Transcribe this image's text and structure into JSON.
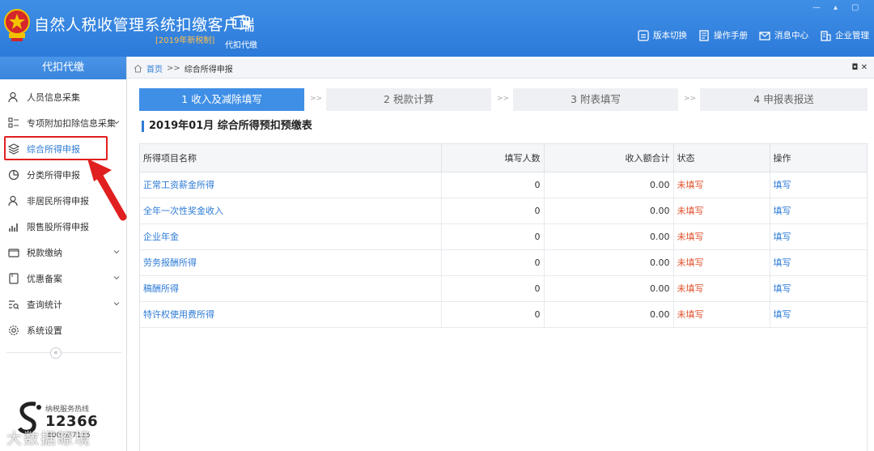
{
  "header": {
    "title": "自然人税收管理系统扣缴客户端",
    "subtitle": "[2019年新税制]",
    "module": "代扣代缴",
    "window_ctrl": "▴",
    "links": [
      {
        "label": "版本切换",
        "icon": "switch-icon"
      },
      {
        "label": "操作手册",
        "icon": "manual-icon"
      },
      {
        "label": "消息中心",
        "icon": "mail-icon"
      },
      {
        "label": "企业管理",
        "icon": "building-icon"
      }
    ]
  },
  "sidebar": {
    "heading": "代扣代缴",
    "items": [
      {
        "label": "人员信息采集",
        "icon": "person-icon",
        "expandable": false
      },
      {
        "label": "专项附加扣除信息采集",
        "icon": "grid-list-icon",
        "expandable": true
      },
      {
        "label": "综合所得申报",
        "icon": "layers-icon",
        "expandable": false,
        "active": true
      },
      {
        "label": "分类所得申报",
        "icon": "pie-icon",
        "expandable": false
      },
      {
        "label": "非居民所得申报",
        "icon": "person-icon",
        "expandable": false
      },
      {
        "label": "限售股所得申报",
        "icon": "bar-chart-icon",
        "expandable": false
      },
      {
        "label": "税款缴纳",
        "icon": "wallet-icon",
        "expandable": true
      },
      {
        "label": "优惠备案",
        "icon": "document-icon",
        "expandable": true
      },
      {
        "label": "查询统计",
        "icon": "search-list-icon",
        "expandable": true
      },
      {
        "label": "系统设置",
        "icon": "gear-icon",
        "expandable": false
      }
    ],
    "collapse": "«",
    "hotline_label": "纳税服务热线",
    "hotline_number": "12366",
    "hotline_web": "400 ull7115",
    "watermark": "大数据瞭境"
  },
  "breadcrumb": {
    "home": "首页",
    "sep": ">>",
    "current": "综合所得申报",
    "close": "◘ ✕"
  },
  "steps": [
    {
      "label": "1 收入及减除填写",
      "active": true
    },
    {
      "label": "2 税款计算",
      "active": false
    },
    {
      "label": "3 附表填写",
      "active": false
    },
    {
      "label": "4 申报表报送",
      "active": false
    }
  ],
  "step_sep": ">>",
  "report_title": "2019年01月   综合所得预扣预缴表",
  "table": {
    "headers": [
      "所得项目名称",
      "填写人数",
      "收入额合计",
      "状态",
      "操作"
    ],
    "rows": [
      [
        "正常工资薪金所得",
        "0",
        "0.00",
        "未填写",
        "填写"
      ],
      [
        "全年一次性奖金收入",
        "0",
        "0.00",
        "未填写",
        "填写"
      ],
      [
        "企业年金",
        "0",
        "0.00",
        "未填写",
        "填写"
      ],
      [
        "劳务报酬所得",
        "0",
        "0.00",
        "未填写",
        "填写"
      ],
      [
        "稿酬所得",
        "0",
        "0.00",
        "未填写",
        "填写"
      ],
      [
        "特许权使用费所得",
        "0",
        "0.00",
        "未填写",
        "填写"
      ]
    ]
  },
  "colors": {
    "brand_blue": "#3f8fe6",
    "link_blue": "#2d7bd6",
    "status_red": "#e0502b",
    "annotation_red": "#e02020"
  }
}
